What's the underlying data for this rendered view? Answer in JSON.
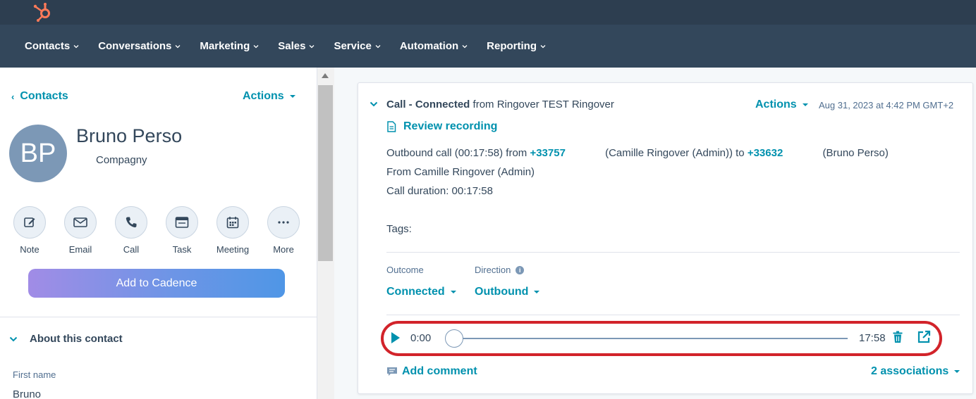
{
  "nav": {
    "items": [
      "Contacts",
      "Conversations",
      "Marketing",
      "Sales",
      "Service",
      "Automation",
      "Reporting"
    ]
  },
  "left": {
    "back_label": "Contacts",
    "actions_label": "Actions",
    "avatar_initials": "BP",
    "contact_name": "Bruno Perso",
    "company": "Compagny",
    "quick_actions": [
      {
        "label": "Note",
        "icon": "pencil-icon"
      },
      {
        "label": "Email",
        "icon": "envelope-icon"
      },
      {
        "label": "Call",
        "icon": "phone-icon"
      },
      {
        "label": "Task",
        "icon": "task-icon"
      },
      {
        "label": "Meeting",
        "icon": "calendar-icon"
      },
      {
        "label": "More",
        "icon": "ellipsis-icon"
      }
    ],
    "cadence_label": "Add to Cadence",
    "about_label": "About this contact",
    "first_name_label": "First name",
    "first_name_value": "Bruno"
  },
  "card": {
    "title_bold": "Call - Connected",
    "title_rest": " from Ringover TEST Ringover",
    "actions_label": "Actions",
    "date": "Aug 31, 2023 at 4:42 PM GMT+2",
    "review_label": "Review recording",
    "line1_prefix": "Outbound call (00:17:58) from ",
    "line1_from_number": "+33757",
    "line1_middle": " (Camille Ringover (Admin)) to ",
    "line1_to_number": "+33632",
    "line1_suffix": " (Bruno Perso)",
    "line2": "From Camille Ringover (Admin)",
    "line3": "Call duration: 00:17:58",
    "tags_label": "Tags:",
    "outcome_label": "Outcome",
    "outcome_value": "Connected",
    "direction_label": "Direction",
    "direction_value": "Outbound",
    "player": {
      "current_time": "0:00",
      "total_time": "17:58",
      "progress": 0
    },
    "add_comment_label": "Add comment",
    "associations_label": "2 associations"
  },
  "colors": {
    "accent": "#0091ae",
    "topbar": "#2d3e50",
    "navbar": "#33475b",
    "highlight": "#d2232a",
    "logo": "#ff7a59"
  }
}
